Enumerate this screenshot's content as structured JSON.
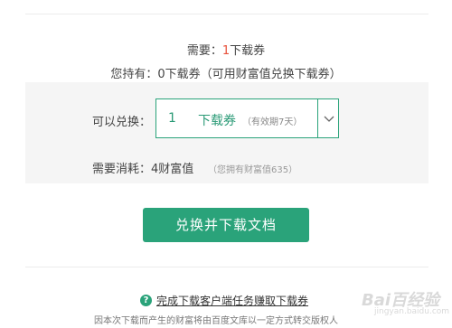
{
  "need": {
    "prefix": "需要：",
    "count": "1",
    "suffix": "下载券"
  },
  "hold": {
    "text": "您持有：0下载券（可用财富值兑换下载券）"
  },
  "exchange": {
    "label": "可以兑换：",
    "quantity": "1",
    "unit": "下载券",
    "validity_note": "（有效期7天）"
  },
  "consume": {
    "label": "需要消耗：4财富值",
    "note": "（您拥有财富值635）"
  },
  "download_button": {
    "label": "兑换并下载文档"
  },
  "task_link": {
    "label": "完成下载客户端任务赚取下载券"
  },
  "bottom_note": {
    "text": "因本次下载而产生的财富将由百度文库以一定方式转交版权人"
  },
  "watermark": {
    "text": "Bai百经验",
    "sub": "jingyan.baidu.com"
  },
  "icons": {
    "dropdown": "chevron-down-icon",
    "help": "question-circle-icon"
  },
  "colors": {
    "accent": "#2aa37a",
    "highlight": "#e8503a"
  }
}
